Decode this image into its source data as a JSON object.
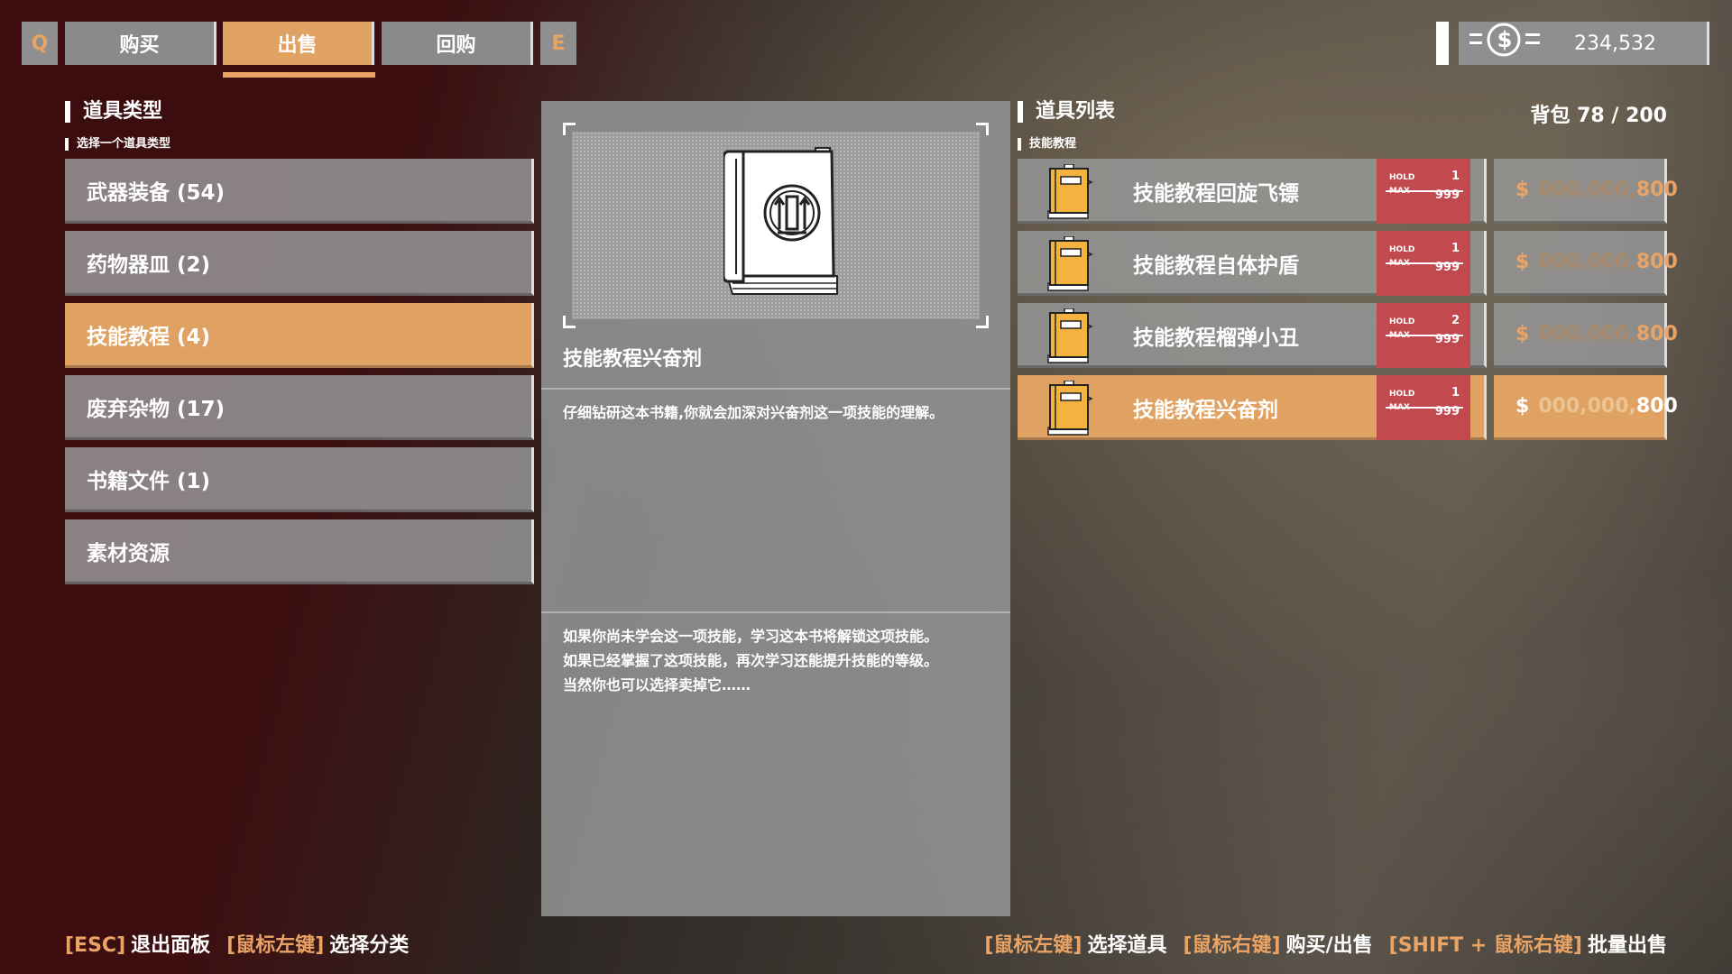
{
  "top_bar": {
    "left_key": "Q",
    "right_key": "E",
    "tabs": [
      {
        "label": "购买",
        "active": false
      },
      {
        "label": "出售",
        "active": true
      },
      {
        "label": "回购",
        "active": false
      }
    ],
    "money_icon": "dollar-coin-icon",
    "money": "234,532"
  },
  "categories_panel": {
    "title": "道具类型",
    "subtitle": "选择一个道具类型",
    "items": [
      {
        "label": "武器装备 (54)",
        "active": false
      },
      {
        "label": "药物器皿 (2)",
        "active": false
      },
      {
        "label": "技能教程 (4)",
        "active": true
      },
      {
        "label": "废弃杂物 (17)",
        "active": false
      },
      {
        "label": "书籍文件 (1)",
        "active": false
      },
      {
        "label": "素材资源",
        "active": false
      }
    ]
  },
  "detail": {
    "icon": "skill-book-icon",
    "name": "技能教程兴奋剂",
    "description": "仔细钻研这本书籍,你就会加深对兴奋剂这一项技能的理解。",
    "lore": [
      "如果你尚未学会这一项技能，学习这本书将解锁这项技能。",
      "如果已经掌握了这项技能，再次学习还能提升技能的等级。",
      "当然你也可以选择卖掉它……"
    ]
  },
  "items_panel": {
    "title": "道具列表",
    "subtitle": "技能教程",
    "backpack": "背包 78 / 200",
    "hold_label": "HOLD",
    "max_label": "MAX",
    "currency": "$",
    "items": [
      {
        "name": "技能教程回旋飞镖",
        "hold": "1",
        "max": "999",
        "price_zeros": "000,000,",
        "price": "800",
        "active": false
      },
      {
        "name": "技能教程自体护盾",
        "hold": "1",
        "max": "999",
        "price_zeros": "000,000,",
        "price": "800",
        "active": false
      },
      {
        "name": "技能教程榴弹小丑",
        "hold": "2",
        "max": "999",
        "price_zeros": "000,000,",
        "price": "800",
        "active": false
      },
      {
        "name": "技能教程兴奋剂",
        "hold": "1",
        "max": "999",
        "price_zeros": "000,000,",
        "price": "800",
        "active": true
      }
    ]
  },
  "footer": {
    "left": [
      {
        "key": "[ESC]",
        "action": "退出面板"
      },
      {
        "key": "[鼠标左键]",
        "action": "选择分类"
      }
    ],
    "right": [
      {
        "key": "[鼠标左键]",
        "action": "选择道具"
      },
      {
        "key": "[鼠标右键]",
        "action": "购买/出售"
      },
      {
        "key": "[SHIFT + 鼠标右键]",
        "action": "批量出售"
      }
    ]
  }
}
